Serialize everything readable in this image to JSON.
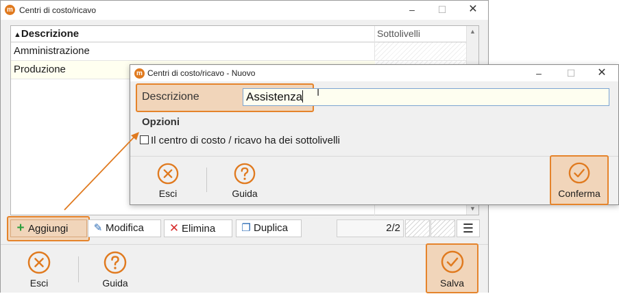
{
  "main_window": {
    "title": "Centri di costo/ricavo",
    "table": {
      "columns": [
        "Descrizione",
        "Sottolivelli"
      ],
      "sort_indicator": "▲",
      "rows": [
        "Amministrazione",
        "Produzione"
      ]
    },
    "toolbar": {
      "add_label": "Aggiungi",
      "edit_label": "Modifica",
      "delete_label": "Elimina",
      "duplicate_label": "Duplica",
      "record_counter": "2/2"
    },
    "footer": {
      "exit_label": "Esci",
      "help_label": "Guida",
      "save_label": "Salva"
    }
  },
  "dialog": {
    "title": "Centri di costo/ricavo - Nuovo",
    "description_label": "Descrizione",
    "description_value": "Assistenza",
    "options_title": "Opzioni",
    "has_sublevels_label": "Il centro di costo / ricavo ha dei sottolivelli",
    "has_sublevels_checked": false,
    "footer": {
      "exit_label": "Esci",
      "help_label": "Guida",
      "confirm_label": "Conferma"
    }
  },
  "icons": {
    "app": "app-logo-icon",
    "exit": "close-circle-icon",
    "help": "help-circle-icon",
    "confirm": "check-circle-icon",
    "add": "plus-icon",
    "edit": "edit-icon",
    "delete": "x-icon",
    "duplicate": "copy-icon",
    "menu": "hamburger-menu-icon"
  },
  "colors": {
    "accent": "#e07a1f",
    "highlight_border": "#e5832a",
    "highlight_fill": "#f2c08e",
    "add_icon": "#2e9e3e",
    "delete_icon": "#d62b2b",
    "input_border": "#7aa4d2"
  }
}
